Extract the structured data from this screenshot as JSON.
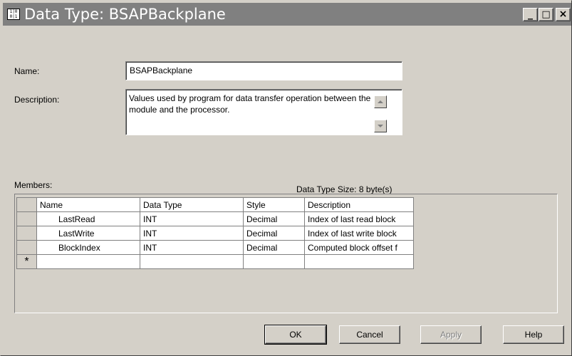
{
  "window": {
    "title": "Data Type:  BSAPBackplane",
    "icon_text": "1|0 0|1",
    "controls": {
      "minimize": "_",
      "maximize": "□",
      "close": "×"
    }
  },
  "form": {
    "name_label": "Name:",
    "name_value": "BSAPBackplane",
    "description_label": "Description:",
    "description_value": "Values used by program for data transfer operation between the module and the processor."
  },
  "members": {
    "label": "Members:",
    "size_text": "Data Type Size: 8 byte(s)",
    "columns": [
      "Name",
      "Data Type",
      "Style",
      "Description"
    ],
    "rows": [
      {
        "name": "LastRead",
        "data_type": "INT",
        "style": "Decimal",
        "description": "Index of last read block"
      },
      {
        "name": "LastWrite",
        "data_type": "INT",
        "style": "Decimal",
        "description": "Index of last write block"
      },
      {
        "name": "BlockIndex",
        "data_type": "INT",
        "style": "Decimal",
        "description": "Computed block offset f"
      }
    ],
    "new_row_marker": "*"
  },
  "buttons": {
    "ok": "OK",
    "cancel": "Cancel",
    "apply": "Apply",
    "help": "Help"
  },
  "colors": {
    "face": "#d4d0c8",
    "titlebar_inactive": "#808080"
  }
}
